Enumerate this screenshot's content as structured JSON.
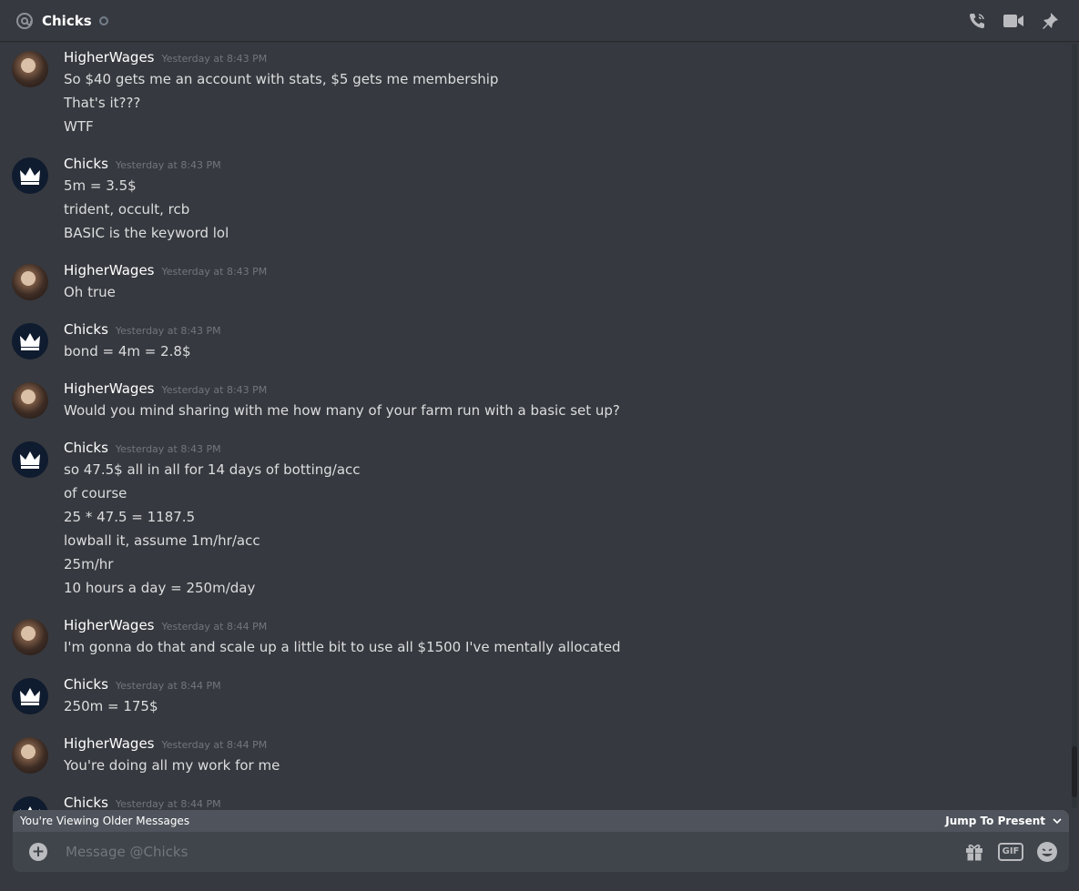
{
  "header": {
    "title": "Chicks",
    "icons": [
      "at-icon",
      "call-icon",
      "video-icon",
      "pin-icon"
    ]
  },
  "messages": [
    {
      "author": "HigherWages",
      "timestamp": "Yesterday at 8:43 PM",
      "avatar": "higherwages",
      "lines": [
        "So $40 gets me an account with stats, $5 gets me membership",
        "That's it???",
        "WTF"
      ]
    },
    {
      "author": "Chicks",
      "timestamp": "Yesterday at 8:43 PM",
      "avatar": "chicks",
      "lines": [
        "5m = 3.5$",
        "trident, occult, rcb",
        "BASIC is the keyword lol"
      ]
    },
    {
      "author": "HigherWages",
      "timestamp": "Yesterday at 8:43 PM",
      "avatar": "higherwages",
      "lines": [
        "Oh true"
      ]
    },
    {
      "author": "Chicks",
      "timestamp": "Yesterday at 8:43 PM",
      "avatar": "chicks",
      "lines": [
        "bond = 4m = 2.8$"
      ]
    },
    {
      "author": "HigherWages",
      "timestamp": "Yesterday at 8:43 PM",
      "avatar": "higherwages",
      "lines": [
        "Would you mind sharing with me how many of your farm run with a basic set up?"
      ]
    },
    {
      "author": "Chicks",
      "timestamp": "Yesterday at 8:43 PM",
      "avatar": "chicks",
      "lines": [
        "so 47.5$ all in all for 14 days of botting/acc",
        "of course",
        "25 * 47.5 = 1187.5",
        "lowball it, assume 1m/hr/acc",
        "25m/hr",
        "10 hours a day = 250m/day"
      ]
    },
    {
      "author": "HigherWages",
      "timestamp": "Yesterday at 8:44 PM",
      "avatar": "higherwages",
      "lines": [
        "I'm gonna do that and scale up a little bit to use all $1500 I've mentally allocated"
      ]
    },
    {
      "author": "Chicks",
      "timestamp": "Yesterday at 8:44 PM",
      "avatar": "chicks",
      "lines": [
        "250m = 175$"
      ]
    },
    {
      "author": "HigherWages",
      "timestamp": "Yesterday at 8:44 PM",
      "avatar": "higherwages",
      "lines": [
        "You're doing all my work for me"
      ]
    },
    {
      "author": "Chicks",
      "timestamp": "Yesterday at 8:44 PM",
      "avatar": "chicks",
      "lines": []
    }
  ],
  "older_bar": {
    "text": "You're Viewing Older Messages",
    "jump_label": "Jump To Present"
  },
  "composer": {
    "placeholder": "Message @Chicks",
    "icons": [
      "add-icon",
      "gift-icon",
      "gif-icon",
      "emoji-icon"
    ]
  },
  "colors": {
    "background": "#36393f",
    "composer": "#40444b",
    "older_bar": "#4f545c",
    "username": "#ffffff",
    "text": "#dcddde",
    "timestamp": "#72767d"
  }
}
